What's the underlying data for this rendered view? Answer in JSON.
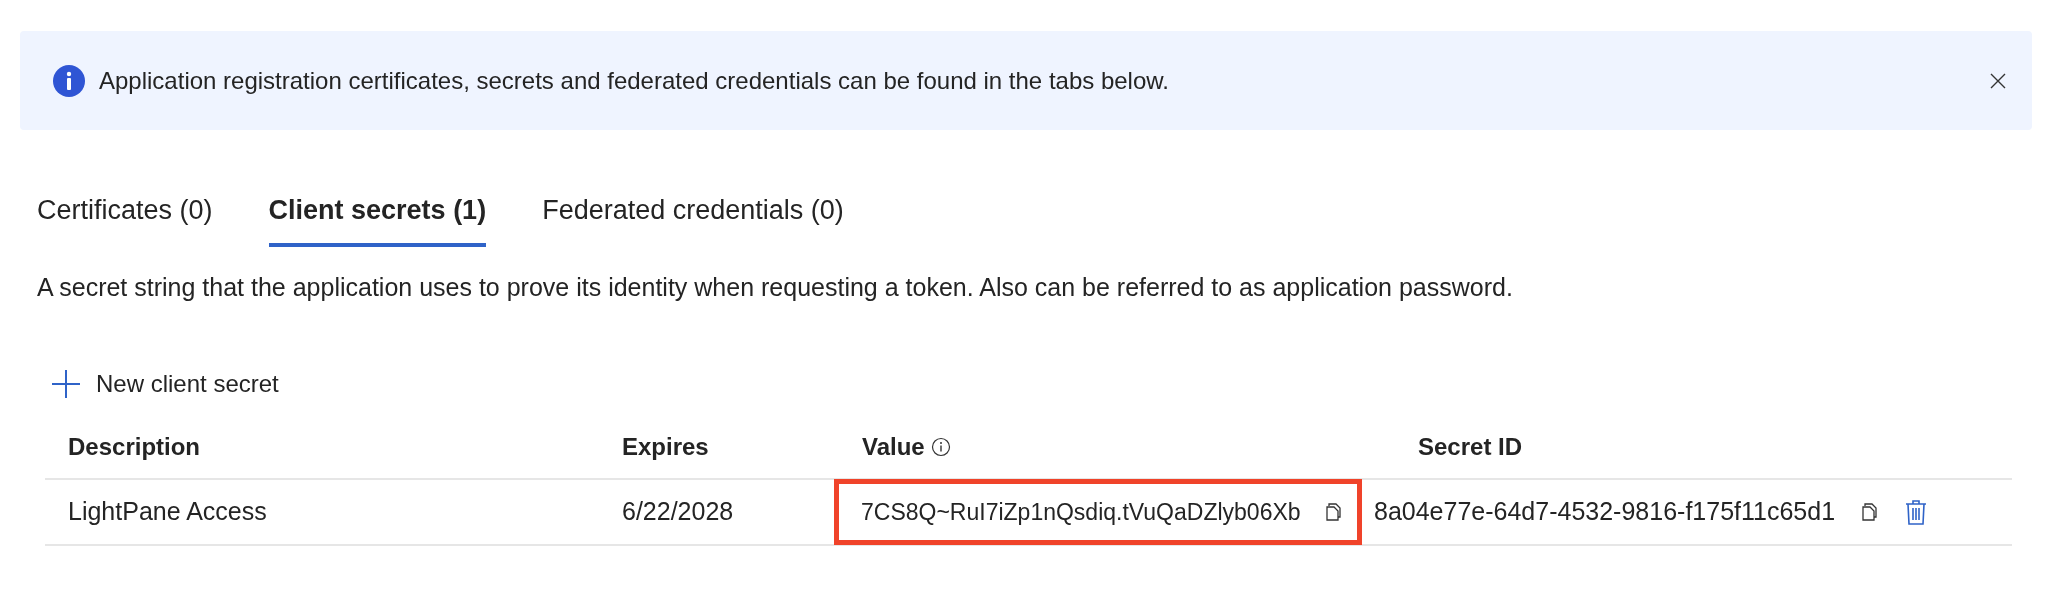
{
  "banner": {
    "message": "Application registration certificates, secrets and federated credentials can be found in the tabs below."
  },
  "tabs": [
    {
      "label": "Certificates (0)",
      "selected": false
    },
    {
      "label": "Client secrets (1)",
      "selected": true
    },
    {
      "label": "Federated credentials (0)",
      "selected": false
    }
  ],
  "description": "A secret string that the application uses to prove its identity when requesting a token. Also can be referred to as application password.",
  "new_button": "New client secret",
  "table": {
    "columns": [
      {
        "label": "Description",
        "info": false
      },
      {
        "label": "Expires",
        "info": false
      },
      {
        "label": "Value",
        "info": true
      },
      {
        "label": "Secret ID",
        "info": false
      }
    ],
    "rows": [
      {
        "description": "LightPane Access",
        "expires": "6/22/2028",
        "value": "7CS8Q~RuI7iZp1nQsdiq.tVuQaDZlyb06Xb",
        "value_highlighted": true,
        "secret_id": "8a04e77e-64d7-4532-9816-f175f11c65d1"
      }
    ]
  }
}
